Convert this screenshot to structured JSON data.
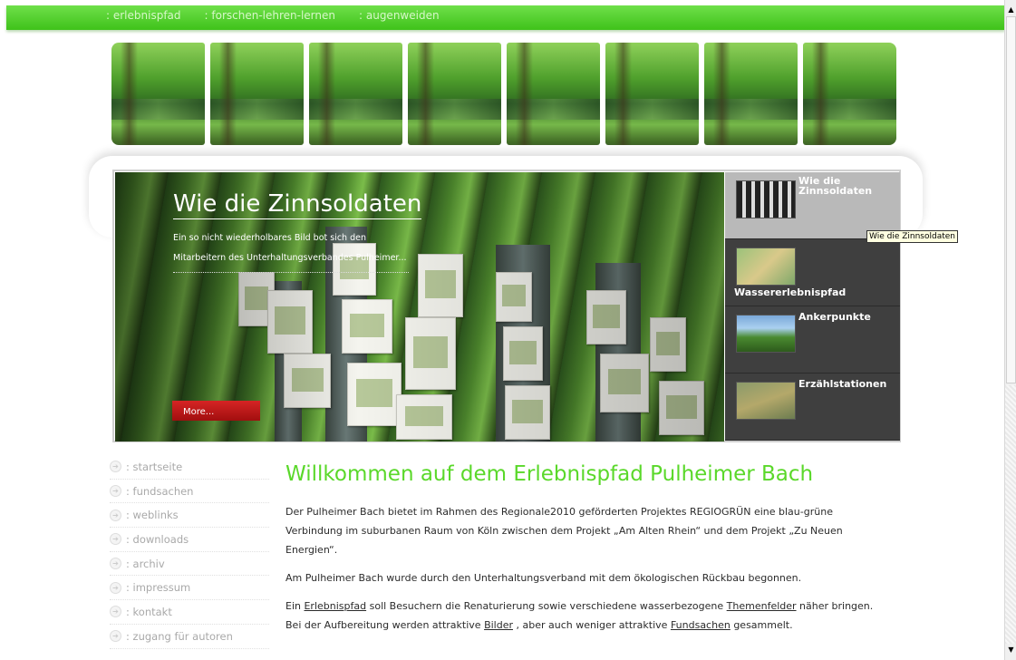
{
  "topnav": {
    "items": [
      ": erlebnispfad",
      ": forschen-lehren-lernen",
      ": augenweiden"
    ]
  },
  "slider": {
    "title": "Wie die Zinnsoldaten",
    "text": "Ein so nicht wiederholbares Bild bot sich den Mitarbeitern des Unterhaltungsverbandes Pulheimer...",
    "more_label": "More...",
    "thumbs": [
      {
        "label": "Wie die Zinnsoldaten",
        "active": true
      },
      {
        "label": "Wassererlebnispfad",
        "active": false
      },
      {
        "label": "Ankerpunkte",
        "active": false
      },
      {
        "label": "Erzählstationen",
        "active": false
      }
    ],
    "tooltip": "Wie die Zinnsoldaten"
  },
  "menu": {
    "items": [
      ": startseite",
      ": fundsachen",
      ": weblinks",
      ": downloads",
      ": archiv",
      ": impressum",
      ": kontakt",
      ": zugang für autoren"
    ]
  },
  "content": {
    "heading": "Willkommen auf dem Erlebnispfad Pulheimer Bach",
    "p1": "Der Pulheimer Bach bietet im Rahmen des Regionale2010 geförderten Projektes REGIOGRÜN eine blau-grüne Verbindung im suburbanen Raum von Köln zwischen dem Projekt „Am Alten Rhein“ und dem Projekt „Zu Neuen Energien“.",
    "p2": "Am Pulheimer Bach wurde durch den Unterhaltungsverband mit dem ökologischen Rückbau begonnen.",
    "p3": {
      "t1": "Ein ",
      "link1": "Erlebnispfad",
      "t2": " soll Besuchern die Renaturierung sowie verschiedene wasserbezogene ",
      "link2": "Themenfelder",
      "t3": " näher bringen. Bei der Aufbereitung werden attraktive ",
      "link3": "Bilder",
      "t4": " , aber auch weniger attraktive ",
      "link4": "Fundsachen",
      "t5": " gesammelt."
    }
  },
  "colors": {
    "accent_green": "#5ad82a",
    "nav_green": "#3fc21a",
    "button_red": "#c61a1a"
  }
}
